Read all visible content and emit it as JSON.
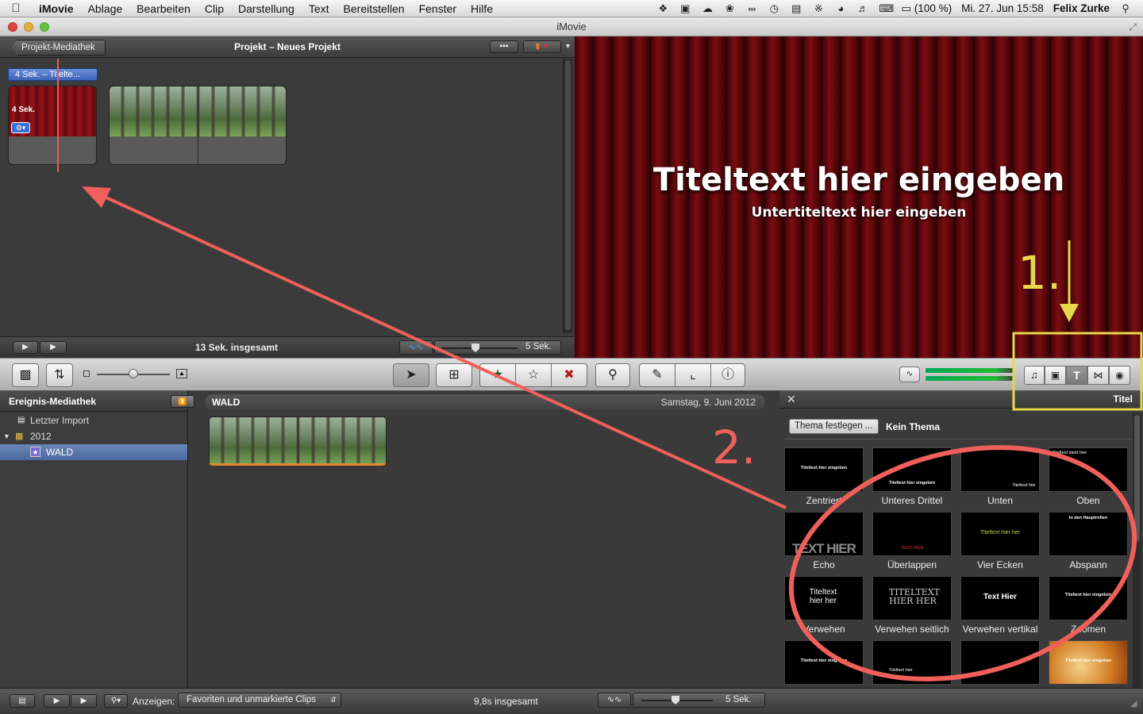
{
  "menubar": {
    "app": "iMovie",
    "items": [
      "Ablage",
      "Bearbeiten",
      "Clip",
      "Darstellung",
      "Text",
      "Bereitstellen",
      "Fenster",
      "Hilfe"
    ],
    "battery": "(100 %)",
    "datetime": "Mi. 27. Jun  15:58",
    "user": "Felix Zurke"
  },
  "window": {
    "title": "iMovie"
  },
  "project": {
    "back_button": "Projekt-Mediathek",
    "title": "Projekt – Neues Projekt",
    "title_clip_label": "4 Sek. – Titelte...",
    "clip_duration": "4 Sek.",
    "total": "13 Sek. insgesamt",
    "zoom_label": "5 Sek."
  },
  "viewer": {
    "title_text": "Titeltext hier eingeben",
    "subtitle_text": "Untertiteltext hier eingeben"
  },
  "event_library": {
    "header": "Ereignis-Mediathek",
    "items": [
      {
        "label": "Letzter Import"
      },
      {
        "label": "2012"
      },
      {
        "label": "WALD"
      }
    ]
  },
  "event_browser": {
    "event_name": "WALD",
    "date": "Samstag, 9. Juni 2012"
  },
  "titles_browser": {
    "panel_label": "Titel",
    "theme_button": "Thema festlegen ...",
    "theme_value": "Kein Thema",
    "items": [
      {
        "label": "Zentriert",
        "preview": "Titeltext hier eingeben"
      },
      {
        "label": "Unteres Drittel",
        "preview": "Titeltext hier eingeben"
      },
      {
        "label": "Unten",
        "preview": "Titeltext hier"
      },
      {
        "label": "Oben",
        "preview": "Titeltext steht hier"
      },
      {
        "label": "Echo",
        "preview": "TEXT HIER"
      },
      {
        "label": "Überlappen",
        "preview": "TEXT HIER"
      },
      {
        "label": "Vier Ecken",
        "preview": "Titeltext hier her"
      },
      {
        "label": "Abspann",
        "preview": "in den Hauptrollen"
      },
      {
        "label": "Verwehen",
        "preview": "Titeltext hier her"
      },
      {
        "label": "Verwehen seitlich",
        "preview": "TITELTEXT HIER HER"
      },
      {
        "label": "Verwehen vertikal",
        "preview": "Text Hier"
      },
      {
        "label": "Zoomen",
        "preview": "Titeltext hier eingeben"
      },
      {
        "label": "",
        "preview": "Titeltext hier eingeben"
      },
      {
        "label": "",
        "preview": "Titeltext hier"
      },
      {
        "label": "",
        "preview": ""
      },
      {
        "label": "",
        "preview": "Titeltext hier eingeben"
      }
    ]
  },
  "bottom_bar": {
    "show_label": "Anzeigen:",
    "filter_value": "Favoriten und unmarkierte Clips",
    "total": "9,8s insgesamt",
    "zoom_label": "5 Sek."
  },
  "annotations": {
    "step1": "1.",
    "step2": "2.",
    "colors": {
      "arrow": "#f0605a",
      "highlight": "#e8d84a"
    }
  }
}
